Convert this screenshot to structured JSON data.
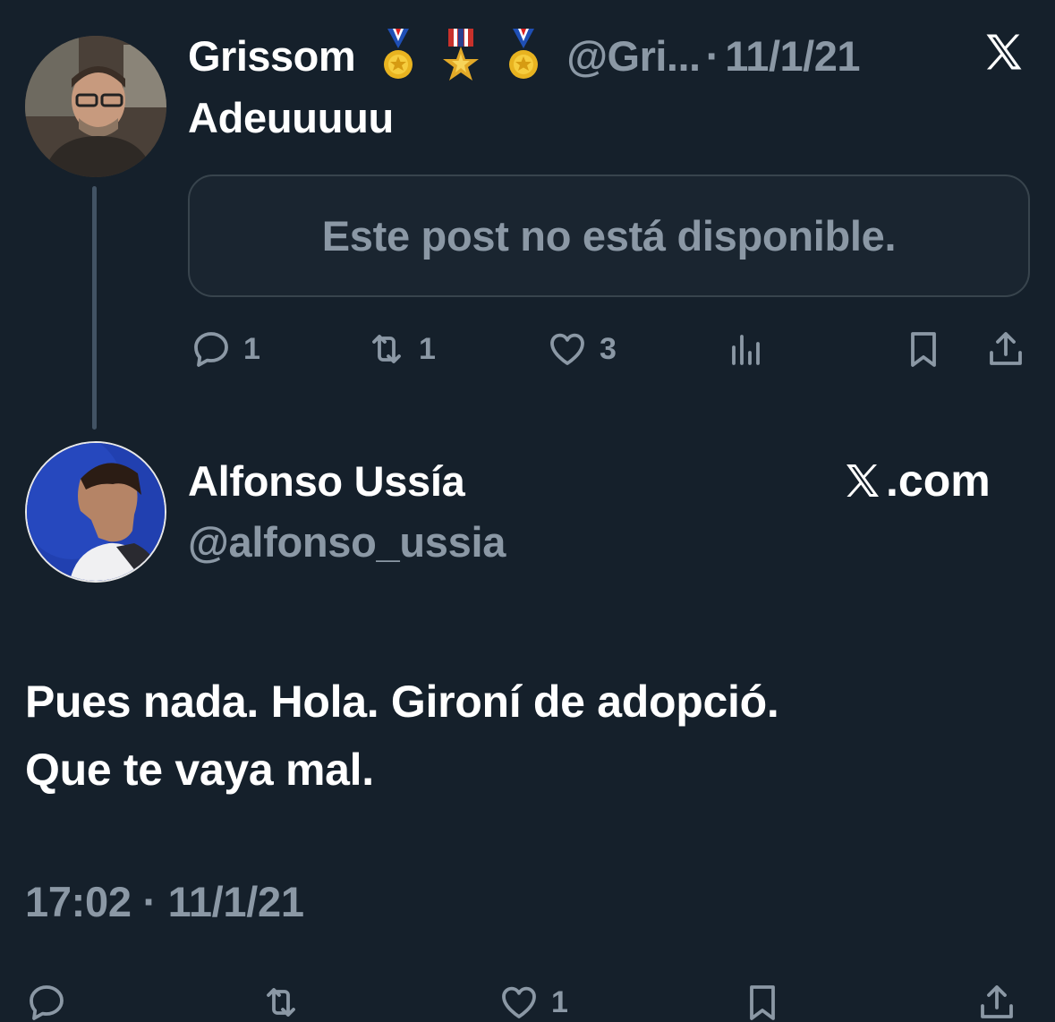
{
  "tweet1": {
    "name": "Grissom",
    "medals": [
      "medal-icon",
      "military-medal-icon",
      "medal-icon"
    ],
    "handle": "@Gri...",
    "dot": "·",
    "date": "11/1/21",
    "text": "Adeuuuuu",
    "unavailable": "Este post no está disponible.",
    "actions": {
      "replies": "1",
      "reposts": "1",
      "likes": "3"
    }
  },
  "tweet2": {
    "name": "Alfonso Ussía",
    "handle": "@alfonso_ussia",
    "source": ".com",
    "body_line1": "Pues nada. Hola. Gironí de adopció.",
    "body_line2": "Que te vaya mal.",
    "timestamp": "17:02 · 11/1/21",
    "actions": {
      "likes": "1"
    }
  },
  "colors": {
    "background": "#15202b",
    "muted": "#8b98a5",
    "border": "#38444d",
    "text": "#ffffff"
  }
}
